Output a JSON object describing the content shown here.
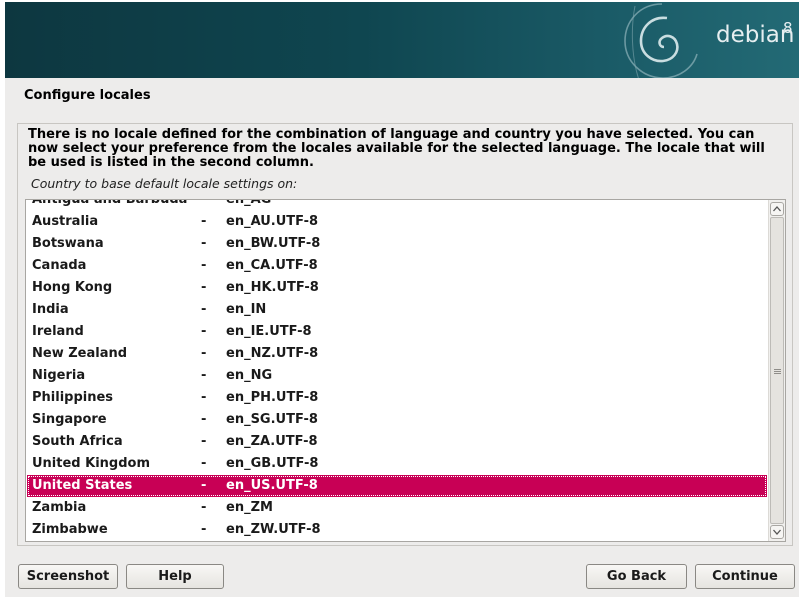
{
  "banner": {
    "logo_text": "debian",
    "version": "8",
    "logo_icon": "debian-swirl-icon"
  },
  "page": {
    "title": "Configure locales",
    "description": "There is no locale defined for the combination of language and country you have selected. You can now select your preference from the locales available for the selected language. The locale that will be used is listed in the second column.",
    "list_label": "Country to base default locale settings on:"
  },
  "locale_list": {
    "separator": "-",
    "selected_index": 14,
    "items": [
      {
        "country": "Antigua and Barbuda",
        "locale": "en_AG"
      },
      {
        "country": "Australia",
        "locale": "en_AU.UTF-8"
      },
      {
        "country": "Botswana",
        "locale": "en_BW.UTF-8"
      },
      {
        "country": "Canada",
        "locale": "en_CA.UTF-8"
      },
      {
        "country": "Hong Kong",
        "locale": "en_HK.UTF-8"
      },
      {
        "country": "India",
        "locale": "en_IN"
      },
      {
        "country": "Ireland",
        "locale": "en_IE.UTF-8"
      },
      {
        "country": "New Zealand",
        "locale": "en_NZ.UTF-8"
      },
      {
        "country": "Nigeria",
        "locale": "en_NG"
      },
      {
        "country": "Philippines",
        "locale": "en_PH.UTF-8"
      },
      {
        "country": "Singapore",
        "locale": "en_SG.UTF-8"
      },
      {
        "country": "South Africa",
        "locale": "en_ZA.UTF-8"
      },
      {
        "country": "United Kingdom",
        "locale": "en_GB.UTF-8"
      },
      {
        "country": "United States",
        "locale": "en_US.UTF-8"
      },
      {
        "country": "Zambia",
        "locale": "en_ZM"
      },
      {
        "country": "Zimbabwe",
        "locale": "en_ZW.UTF-8"
      }
    ]
  },
  "buttons": {
    "screenshot": "Screenshot",
    "help": "Help",
    "go_back": "Go Back",
    "continue": "Continue"
  },
  "colors": {
    "selection": "#c80055",
    "banner": "#0f4650"
  }
}
